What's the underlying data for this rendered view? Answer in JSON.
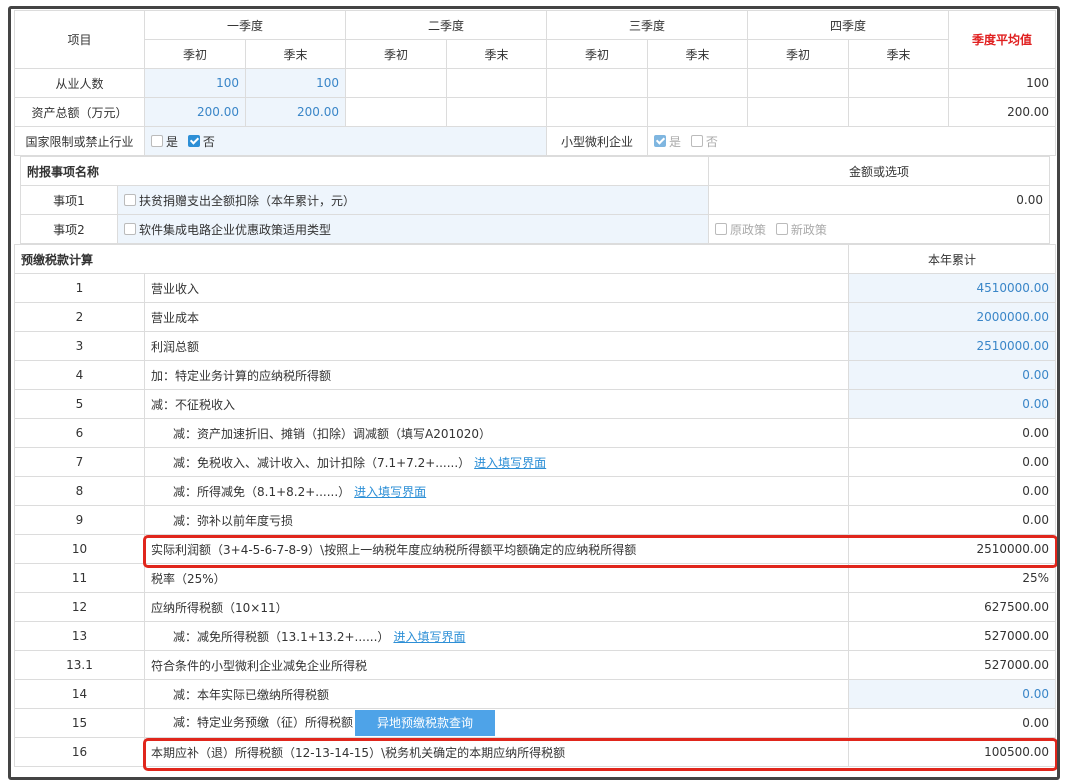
{
  "quarters": {
    "item": "项目",
    "q1": "一季度",
    "q2": "二季度",
    "q3": "三季度",
    "q4": "四季度",
    "start": "季初",
    "end": "季末",
    "avg": "季度平均值"
  },
  "employees": {
    "label": "从业人数",
    "q1_start": "100",
    "q1_end": "100",
    "avg": "100"
  },
  "assets": {
    "label": "资产总额（万元）",
    "q1_start": "200.00",
    "q1_end": "200.00",
    "avg": "200.00"
  },
  "restricted": {
    "label": "国家限制或禁止行业",
    "yes": "是",
    "no": "否",
    "checked": "no"
  },
  "small": {
    "label": "小型微利企业",
    "yes": "是",
    "no": "否",
    "checked": "yes"
  },
  "additional": {
    "header": "附报事项名称",
    "value_header": "金额或选项",
    "item1": {
      "label": "事项1",
      "desc": "扶贫捐赠支出全额扣除（本年累计，元）",
      "value": "0.00"
    },
    "item2": {
      "label": "事项2",
      "desc": "软件集成电路企业优惠政策适用类型",
      "opt1": "原政策",
      "opt2": "新政策"
    }
  },
  "calc": {
    "header": "预缴税款计算",
    "value_header": "本年累计",
    "link_label": "进入填写界面",
    "query_button": "异地预缴税款查询",
    "rows": [
      {
        "no": "1",
        "desc": "营业收入",
        "value": "4510000.00",
        "editable": true
      },
      {
        "no": "2",
        "desc": "营业成本",
        "value": "2000000.00",
        "editable": true
      },
      {
        "no": "3",
        "desc": "利润总额",
        "value": "2510000.00",
        "editable": true
      },
      {
        "no": "4",
        "desc": "加：特定业务计算的应纳税所得额",
        "value": "0.00",
        "editable": true
      },
      {
        "no": "5",
        "desc": "减：不征税收入",
        "value": "0.00",
        "editable": true
      },
      {
        "no": "6",
        "desc": "减：资产加速折旧、摊销（扣除）调减额（填写A201020）",
        "value": "0.00",
        "indent": true
      },
      {
        "no": "7",
        "desc": "减：免税收入、减计收入、加计扣除（7.1+7.2+......）",
        "value": "0.00",
        "indent": true,
        "link": true
      },
      {
        "no": "8",
        "desc": "减：所得减免（8.1+8.2+......）",
        "value": "0.00",
        "indent": true,
        "link": true
      },
      {
        "no": "9",
        "desc": "减：弥补以前年度亏损",
        "value": "0.00",
        "indent": true
      },
      {
        "no": "10",
        "desc": "实际利润额（3+4-5-6-7-8-9）\\按照上一纳税年度应纳税所得额平均额确定的应纳税所得额",
        "value": "2510000.00",
        "highlight": true
      },
      {
        "no": "11",
        "desc": "税率（25%）",
        "value": "25%"
      },
      {
        "no": "12",
        "desc": "应纳所得税额（10×11）",
        "value": "627500.00"
      },
      {
        "no": "13",
        "desc": "减：减免所得税额（13.1+13.2+......）",
        "value": "527000.00",
        "indent": true,
        "link": true
      },
      {
        "no": "13.1",
        "desc": "符合条件的小型微利企业减免企业所得税",
        "value": "527000.00"
      },
      {
        "no": "14",
        "desc": "减：本年实际已缴纳所得税额",
        "value": "0.00",
        "indent": true,
        "editable": true
      },
      {
        "no": "15",
        "desc": "减：特定业务预缴（征）所得税额",
        "value": "0.00",
        "indent": true,
        "button": true
      },
      {
        "no": "16",
        "desc": "本期应补（退）所得税额（12-13-14-15）\\税务机关确定的本期应纳所得税额",
        "value": "100500.00",
        "highlight": true
      }
    ]
  }
}
